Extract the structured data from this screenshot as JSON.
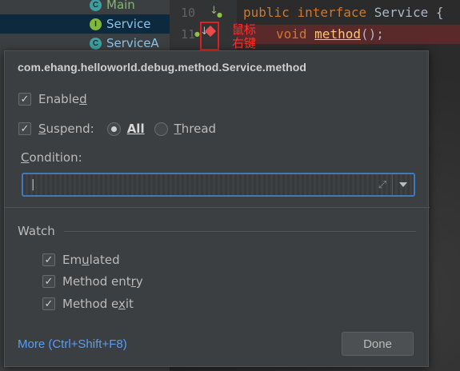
{
  "project_tree": [
    {
      "name": "Main",
      "kind": "class",
      "badge": "C"
    },
    {
      "name": "Service",
      "kind": "interface",
      "badge": "I"
    },
    {
      "name": "ServiceA",
      "kind": "class",
      "badge": "C"
    }
  ],
  "editor": {
    "lines": [
      {
        "num": "10",
        "kw1": "public",
        "kw2": "interface",
        "rest": " Service {"
      },
      {
        "num": "11",
        "kw1": "",
        "kw2": "void",
        "method": "method",
        "rest": "();"
      }
    ],
    "annotation_line1": "鼠标",
    "annotation_line2": "右键"
  },
  "dialog": {
    "title": "com.ehang.helloworld.debug.method.Service.method",
    "enabled": {
      "label_pre": "Enable",
      "label_mnemonic": "d",
      "checked": true
    },
    "suspend": {
      "label_mnemonic": "S",
      "label_post": "uspend:",
      "checked": true
    },
    "suspend_all": {
      "label": "All",
      "selected": true
    },
    "suspend_thread": {
      "label_mnemonic": "T",
      "label_post": "hread",
      "selected": false
    },
    "condition": {
      "label_mnemonic": "C",
      "label_post": "ondition:",
      "value": "|"
    },
    "watch": {
      "title": "Watch",
      "emulated": {
        "label_pre": "Em",
        "label_mnemonic": "u",
        "label_post": "lated",
        "checked": true
      },
      "method_entry": {
        "label_pre": "Method ent",
        "label_mnemonic": "r",
        "label_post": "y",
        "checked": true
      },
      "method_exit": {
        "label_pre": "Method e",
        "label_mnemonic": "x",
        "label_post": "it",
        "checked": true
      }
    },
    "more_link": "More (Ctrl+Shift+F8)",
    "done_label": "Done"
  },
  "colors": {
    "accent": "#3d7cba",
    "link": "#589df6",
    "breakpoint": "#e84c4c"
  }
}
